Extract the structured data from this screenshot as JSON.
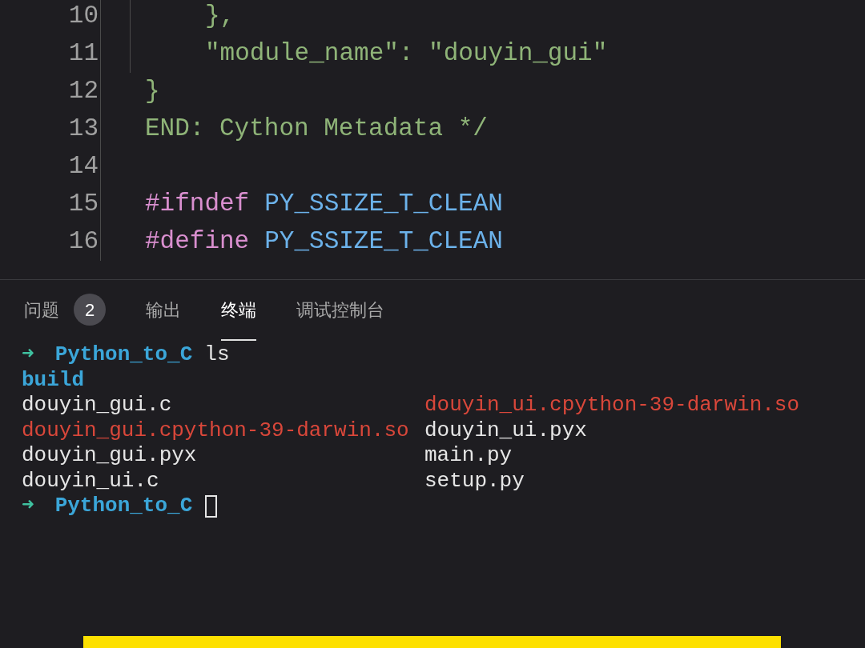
{
  "editor": {
    "lines": [
      {
        "number": "10",
        "nested": true,
        "tokens": [
          {
            "text": "},",
            "kind": "string"
          }
        ]
      },
      {
        "number": "11",
        "nested": true,
        "tokens": [
          {
            "text": "\"module_name\": \"douyin_gui\"",
            "kind": "string"
          }
        ]
      },
      {
        "number": "12",
        "nested": false,
        "tokens": [
          {
            "text": "}",
            "kind": "string"
          }
        ]
      },
      {
        "number": "13",
        "nested": false,
        "tokens": [
          {
            "text": "END: Cython Metadata */",
            "kind": "comment"
          }
        ]
      },
      {
        "number": "14",
        "nested": false
      },
      {
        "number": "15",
        "nested": false,
        "tokens": [
          {
            "text": "#ifndef",
            "kind": "directive"
          },
          {
            "text": "PY_SSIZE_T_CLEAN",
            "kind": "macro"
          }
        ]
      },
      {
        "number": "16",
        "nested": false,
        "tokens": [
          {
            "text": "#define",
            "kind": "directive"
          },
          {
            "text": "PY_SSIZE_T_CLEAN",
            "kind": "macro"
          }
        ]
      }
    ]
  },
  "panel_tabs": [
    {
      "label": "问题",
      "badge": "2",
      "selected": false
    },
    {
      "label": "输出",
      "selected": false
    },
    {
      "label": "终端",
      "selected": true
    },
    {
      "label": "调试控制台",
      "selected": false
    }
  ],
  "terminal": {
    "prompt_arrow": "➜",
    "directory": "Python_to_C",
    "command": "ls",
    "listing": [
      {
        "left": {
          "text": "build",
          "kind": "dir"
        }
      },
      {
        "left": {
          "text": "douyin_gui.c",
          "kind": "file"
        },
        "right": {
          "text": "douyin_ui.cpython-39-darwin.so",
          "kind": "lib"
        }
      },
      {
        "left": {
          "text": "douyin_gui.cpython-39-darwin.so",
          "kind": "lib"
        },
        "right": {
          "text": "douyin_ui.pyx",
          "kind": "file"
        }
      },
      {
        "left": {
          "text": "douyin_gui.pyx",
          "kind": "file"
        },
        "right": {
          "text": "main.py",
          "kind": "file"
        }
      },
      {
        "left": {
          "text": "douyin_ui.c",
          "kind": "file"
        },
        "right": {
          "text": "setup.py",
          "kind": "file"
        }
      }
    ],
    "next_prompt": {
      "arrow": "➜",
      "directory": "Python_to_C"
    }
  }
}
